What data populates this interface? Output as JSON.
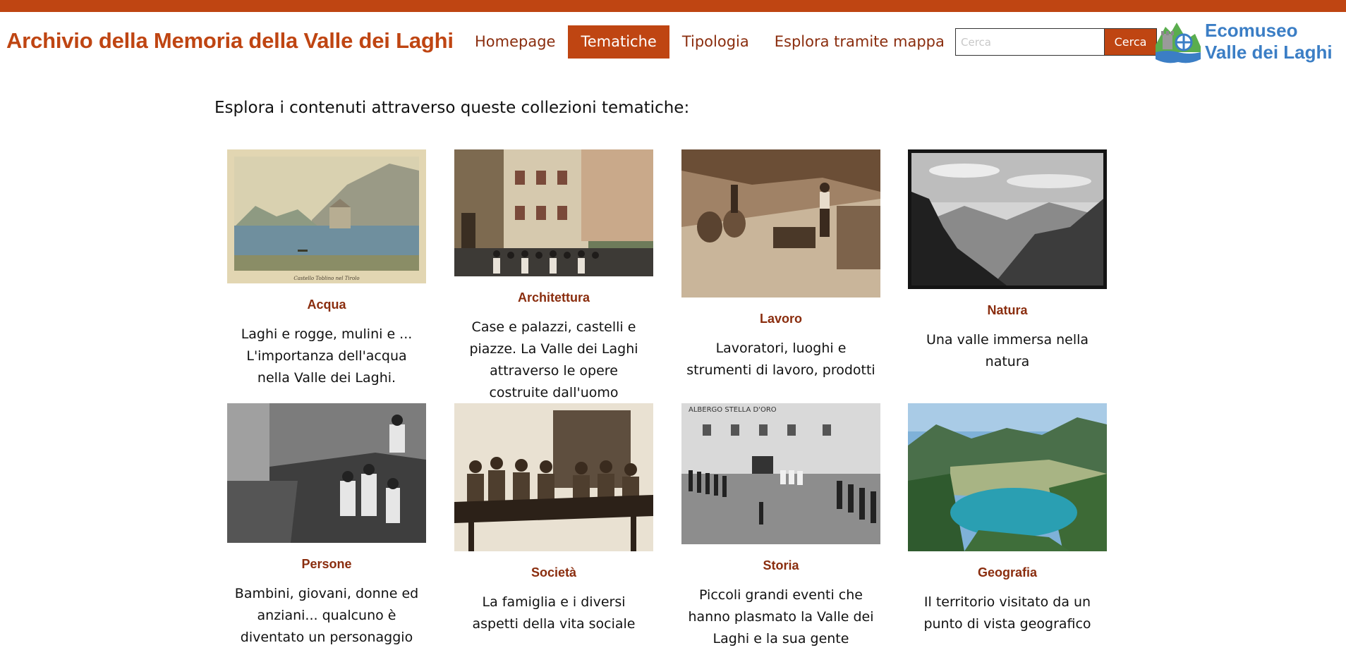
{
  "header": {
    "site_title": "Archivio della Memoria della Valle dei Laghi",
    "nav": [
      {
        "label": "Homepage",
        "active": false
      },
      {
        "label": "Tematiche",
        "active": true
      },
      {
        "label": "Tipologia",
        "active": false
      },
      {
        "label": "Esplora tramite mappa",
        "active": false
      }
    ],
    "search": {
      "placeholder": "Cerca",
      "value": "",
      "button_label": "Cerca"
    },
    "logo": {
      "line1": "Ecomuseo",
      "line2": "Valle dei Laghi",
      "icon": "ecomuseo-logo-icon"
    }
  },
  "colors": {
    "accent": "#bf4512",
    "link": "#8a2d0e",
    "logo_blue": "#3b7ec5",
    "logo_green": "#5aad4e"
  },
  "intro": "Esplora i contenuti attraverso queste collezioni tematiche:",
  "collections": [
    {
      "title": "Acqua",
      "description": "Laghi e rogge, mulini e ... L'importanza dell'acqua nella Valle dei Laghi.",
      "image_caption": "Castello Toblino nel Tirolo",
      "image": "lake-castle-painting"
    },
    {
      "title": "Architettura",
      "description": "Case e palazzi, castelli e piazze. La Valle dei Laghi attraverso le opere costruite dall'uomo",
      "image": "village-street-photo"
    },
    {
      "title": "Lavoro",
      "description": "Lavoratori, luoghi e strumenti di lavoro, prodotti",
      "image": "workers-photo"
    },
    {
      "title": "Natura",
      "description": "Una valle immersa nella natura",
      "image": "mountain-valley-photo"
    },
    {
      "title": "Persone",
      "description": "Bambini, giovani, donne ed anziani... qualcuno è diventato un personaggio",
      "image": "children-photo"
    },
    {
      "title": "Società",
      "description": "La famiglia e i diversi aspetti della vita sociale",
      "image": "classroom-photo"
    },
    {
      "title": "Storia",
      "description": "Piccoli grandi eventi che hanno plasmato la Valle dei Laghi e la sua gente",
      "image_sign": "ALBERGO STELLA D'ORO",
      "image": "village-square-procession-photo"
    },
    {
      "title": "Geografia",
      "description": "Il territorio visitato da un punto di vista geografico",
      "image": "lake-aerial-photo"
    }
  ]
}
